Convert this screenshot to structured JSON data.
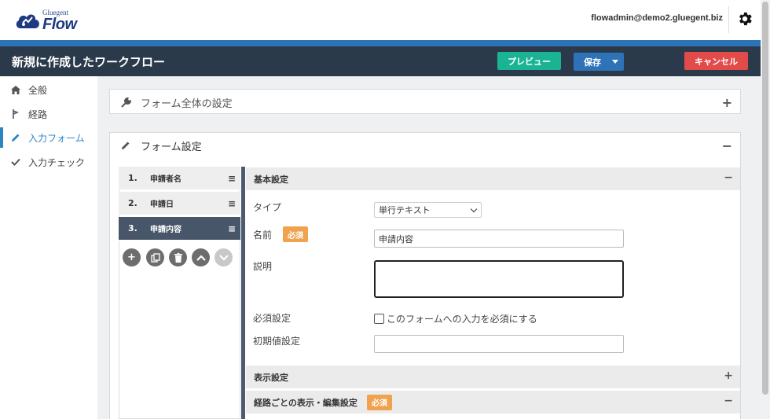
{
  "header": {
    "logo_small": "Gluegent",
    "logo_main": "Flow",
    "user_email": "flowadmin@demo2.gluegent.biz",
    "settings_icon": "gear-icon"
  },
  "titlebar": {
    "title": "新規に作成したワークフロー",
    "preview_label": "プレビュー",
    "save_label": "保存",
    "cancel_label": "キャンセル"
  },
  "colors": {
    "brand_blue": "#2e73b8",
    "titlebar_bg": "#2b3a4a",
    "preview_green": "#1ab394",
    "cancel_red": "#e34b4b",
    "badge_orange": "#f0a24e",
    "active_blue": "#2e86c1"
  },
  "sidebar": {
    "items": [
      {
        "label": "全般",
        "icon": "home-icon"
      },
      {
        "label": "経路",
        "icon": "route-icon"
      },
      {
        "label": "入力フォーム",
        "icon": "pencil-icon",
        "active": true
      },
      {
        "label": "入力チェック",
        "icon": "check-icon"
      }
    ]
  },
  "panels": {
    "form_all": {
      "title": "フォーム全体の設定",
      "toggle": "+"
    },
    "form_settings": {
      "title": "フォーム設定",
      "toggle": "−"
    }
  },
  "fields": [
    {
      "num": "1.",
      "name": "申請者名"
    },
    {
      "num": "2.",
      "name": "申請日"
    },
    {
      "num": "3.",
      "name": "申請内容",
      "active": true
    }
  ],
  "field_tools": [
    "add-icon",
    "copy-icon",
    "trash-icon",
    "move-up-icon",
    "move-down-icon"
  ],
  "basic": {
    "section_title": "基本設定",
    "toggle": "−",
    "type_label": "タイプ",
    "type_value": "単行テキスト",
    "name_label": "名前",
    "required_badge": "必須",
    "name_value": "申請内容",
    "desc_label": "説明",
    "required_label": "必須設定",
    "required_checkbox_text": "このフォームへの入力を必須にする",
    "default_label": "初期値設定"
  },
  "display": {
    "section_title": "表示設定",
    "toggle": "+"
  },
  "route_edit": {
    "section_title": "経路ごとの表示・編集設定",
    "required_badge": "必須",
    "toggle": "−"
  }
}
